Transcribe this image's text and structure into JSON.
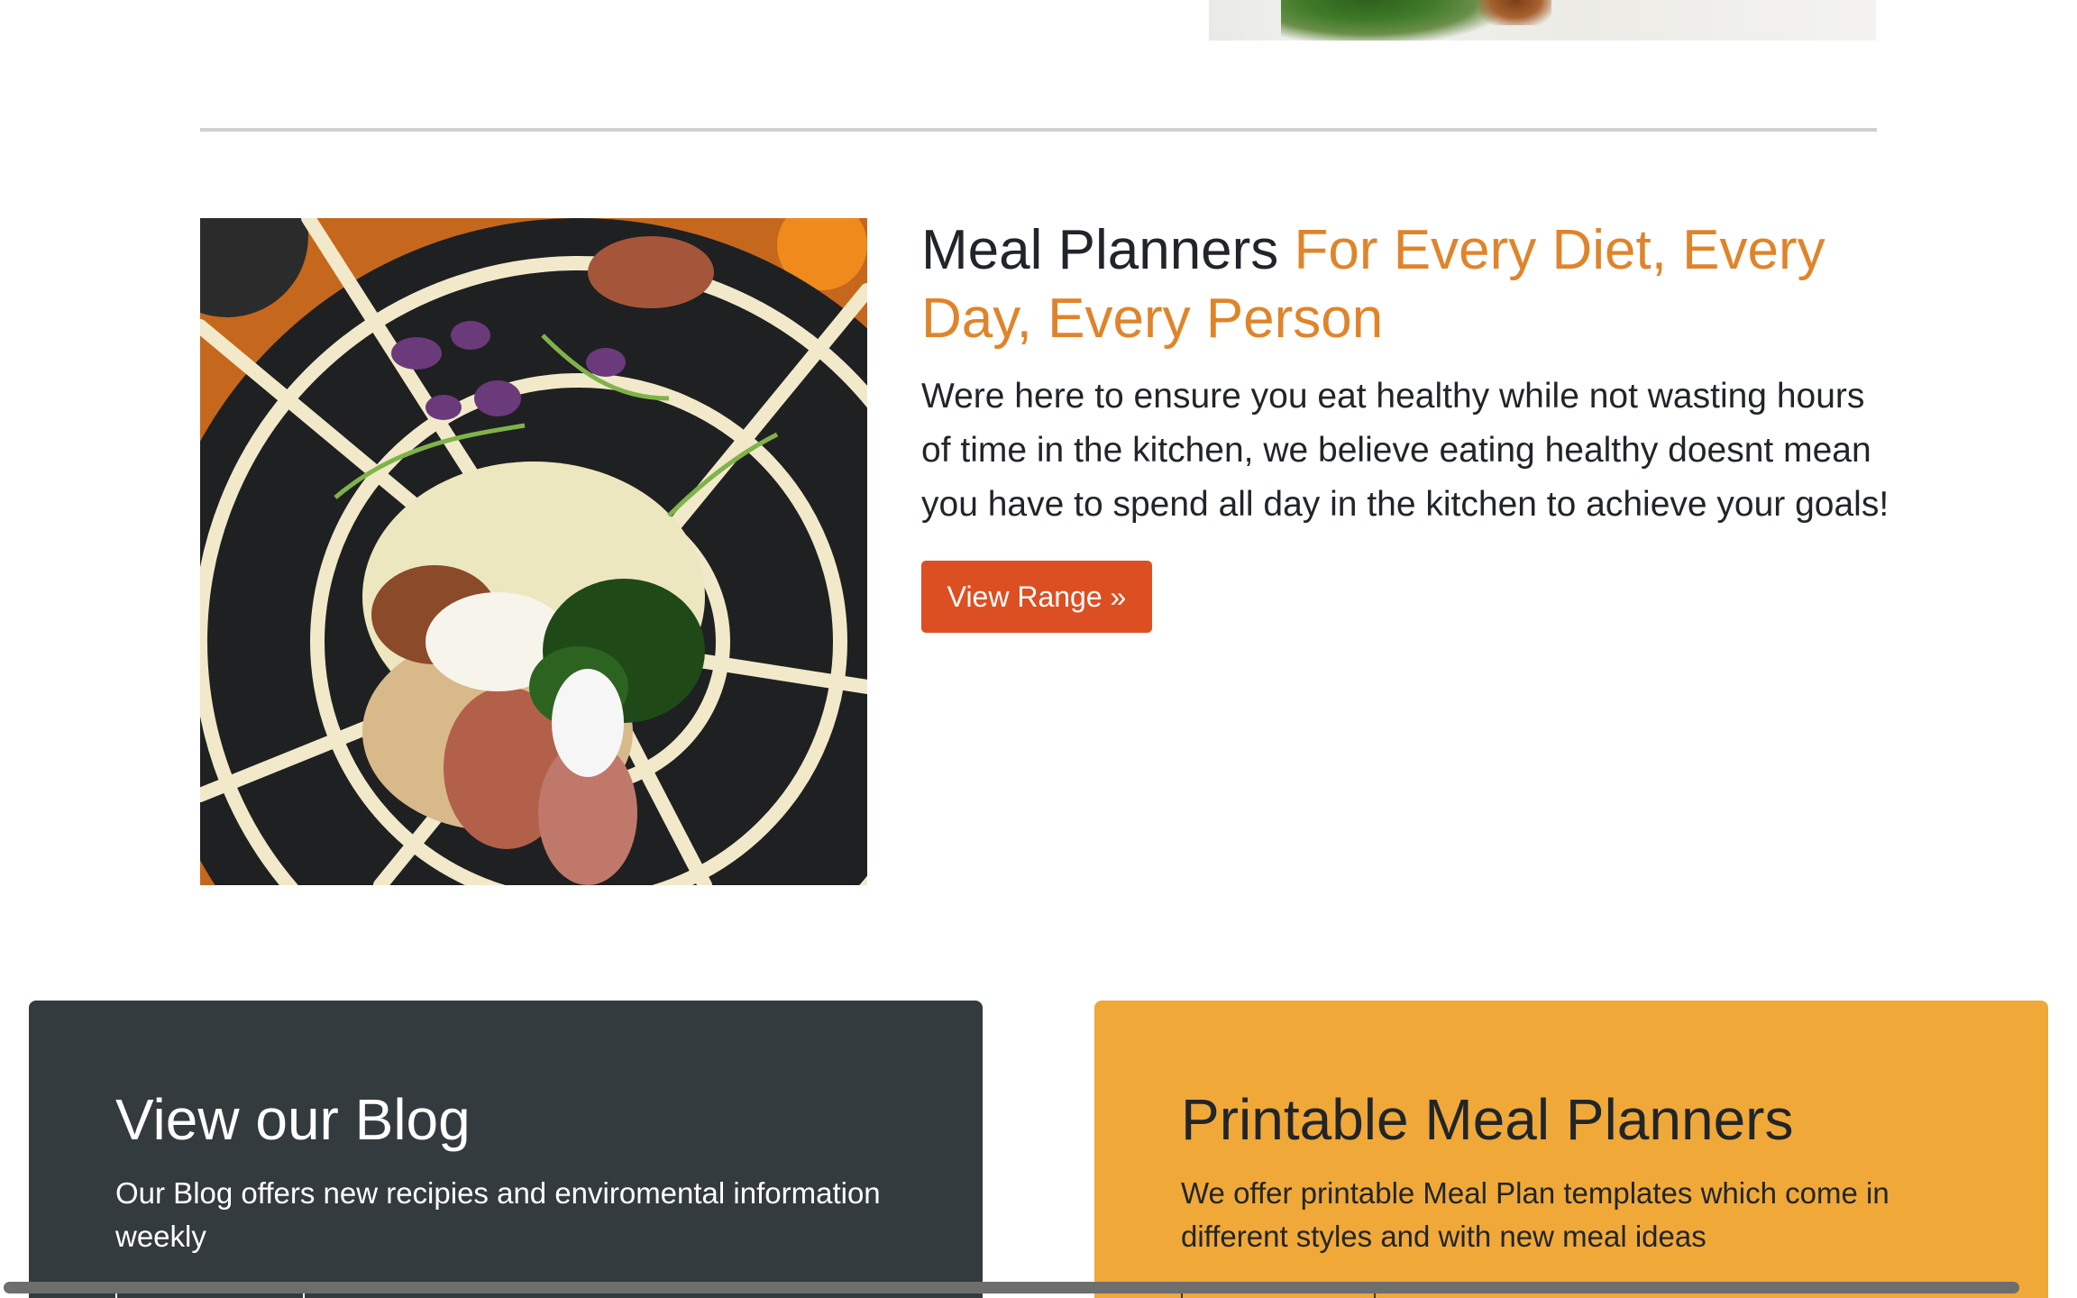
{
  "feature": {
    "heading_main": "Meal Planners ",
    "heading_accent": "For Every Diet, Every Day, Every Person",
    "lead": "Were here to ensure you eat healthy while not wasting hours of time in the kitchen, we believe eating healthy doesnt mean you have to spend all day in the kitchen to achieve your goals!",
    "button_label": "View Range »",
    "accent_color": "#e0842a",
    "button_color": "#dc4f22"
  },
  "cards": {
    "blog": {
      "title": "View our Blog",
      "text": "Our Blog offers new recipies and enviromental information weekly",
      "background": "#343b3f"
    },
    "printable": {
      "title": "Printable Meal Planners",
      "text": "We offer printable Meal Plan templates which come in different styles and with new meal ideas",
      "background": "#f0a838"
    }
  }
}
